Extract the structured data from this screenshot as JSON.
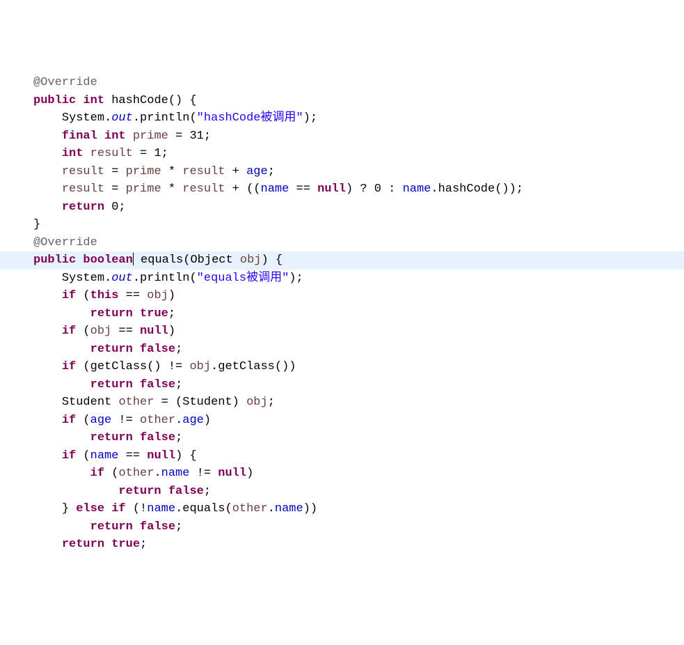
{
  "lines": [
    {
      "indent": 0,
      "tokens": [
        {
          "cls": "annotation",
          "t": "@Override"
        }
      ]
    },
    {
      "indent": 0,
      "tokens": [
        {
          "cls": "keyword",
          "t": "public"
        },
        {
          "cls": "",
          "t": " "
        },
        {
          "cls": "keyword",
          "t": "int"
        },
        {
          "cls": "",
          "t": " "
        },
        {
          "cls": "method",
          "t": "hashCode"
        },
        {
          "cls": "paren",
          "t": "() {"
        }
      ]
    },
    {
      "indent": 1,
      "tokens": [
        {
          "cls": "",
          "t": "System."
        },
        {
          "cls": "static-field",
          "t": "out"
        },
        {
          "cls": "",
          "t": ".println("
        },
        {
          "cls": "string",
          "t": "\"hashCode被调用\""
        },
        {
          "cls": "",
          "t": ");"
        }
      ]
    },
    {
      "indent": 1,
      "tokens": [
        {
          "cls": "keyword",
          "t": "final"
        },
        {
          "cls": "",
          "t": " "
        },
        {
          "cls": "keyword",
          "t": "int"
        },
        {
          "cls": "",
          "t": " "
        },
        {
          "cls": "ident",
          "t": "prime"
        },
        {
          "cls": "",
          "t": " = 31;"
        }
      ]
    },
    {
      "indent": 1,
      "tokens": [
        {
          "cls": "keyword",
          "t": "int"
        },
        {
          "cls": "",
          "t": " "
        },
        {
          "cls": "ident",
          "t": "result"
        },
        {
          "cls": "",
          "t": " = 1;"
        }
      ]
    },
    {
      "indent": 1,
      "tokens": [
        {
          "cls": "ident",
          "t": "result"
        },
        {
          "cls": "",
          "t": " = "
        },
        {
          "cls": "ident",
          "t": "prime"
        },
        {
          "cls": "",
          "t": " * "
        },
        {
          "cls": "ident",
          "t": "result"
        },
        {
          "cls": "",
          "t": " + "
        },
        {
          "cls": "field",
          "t": "age"
        },
        {
          "cls": "",
          "t": ";"
        }
      ]
    },
    {
      "indent": 1,
      "tokens": [
        {
          "cls": "ident",
          "t": "result"
        },
        {
          "cls": "",
          "t": " = "
        },
        {
          "cls": "ident",
          "t": "prime"
        },
        {
          "cls": "",
          "t": " * "
        },
        {
          "cls": "ident",
          "t": "result"
        },
        {
          "cls": "",
          "t": " + (("
        },
        {
          "cls": "field",
          "t": "name"
        },
        {
          "cls": "",
          "t": " == "
        },
        {
          "cls": "keyword",
          "t": "null"
        },
        {
          "cls": "",
          "t": ") ? 0 : "
        },
        {
          "cls": "field",
          "t": "name"
        },
        {
          "cls": "",
          "t": ".hashCode());"
        }
      ]
    },
    {
      "indent": 1,
      "tokens": [
        {
          "cls": "keyword",
          "t": "return"
        },
        {
          "cls": "",
          "t": " 0;"
        }
      ]
    },
    {
      "indent": 0,
      "tokens": [
        {
          "cls": "",
          "t": "}"
        }
      ]
    },
    {
      "indent": 0,
      "tokens": [
        {
          "cls": "annotation",
          "t": "@Override"
        }
      ]
    },
    {
      "indent": 0,
      "highlight": true,
      "tokens": [
        {
          "cls": "keyword",
          "t": "public"
        },
        {
          "cls": "",
          "t": " "
        },
        {
          "cls": "keyword",
          "t": "boolean"
        },
        {
          "cls": "",
          "t": "",
          "cursor": true
        },
        {
          "cls": "",
          "t": " "
        },
        {
          "cls": "method",
          "t": "equals"
        },
        {
          "cls": "",
          "t": "(Object "
        },
        {
          "cls": "ident",
          "t": "obj"
        },
        {
          "cls": "",
          "t": ") {"
        }
      ]
    },
    {
      "indent": 1,
      "tokens": [
        {
          "cls": "",
          "t": "System."
        },
        {
          "cls": "static-field",
          "t": "out"
        },
        {
          "cls": "",
          "t": ".println("
        },
        {
          "cls": "string",
          "t": "\"equals被调用\""
        },
        {
          "cls": "",
          "t": ");"
        }
      ]
    },
    {
      "indent": 1,
      "tokens": [
        {
          "cls": "keyword",
          "t": "if"
        },
        {
          "cls": "",
          "t": " ("
        },
        {
          "cls": "keyword",
          "t": "this"
        },
        {
          "cls": "",
          "t": " == "
        },
        {
          "cls": "ident",
          "t": "obj"
        },
        {
          "cls": "",
          "t": ")"
        }
      ]
    },
    {
      "indent": 2,
      "tokens": [
        {
          "cls": "keyword",
          "t": "return"
        },
        {
          "cls": "",
          "t": " "
        },
        {
          "cls": "keyword",
          "t": "true"
        },
        {
          "cls": "",
          "t": ";"
        }
      ]
    },
    {
      "indent": 1,
      "tokens": [
        {
          "cls": "keyword",
          "t": "if"
        },
        {
          "cls": "",
          "t": " ("
        },
        {
          "cls": "ident",
          "t": "obj"
        },
        {
          "cls": "",
          "t": " == "
        },
        {
          "cls": "keyword",
          "t": "null"
        },
        {
          "cls": "",
          "t": ")"
        }
      ]
    },
    {
      "indent": 2,
      "tokens": [
        {
          "cls": "keyword",
          "t": "return"
        },
        {
          "cls": "",
          "t": " "
        },
        {
          "cls": "keyword",
          "t": "false"
        },
        {
          "cls": "",
          "t": ";"
        }
      ]
    },
    {
      "indent": 1,
      "tokens": [
        {
          "cls": "keyword",
          "t": "if"
        },
        {
          "cls": "",
          "t": " (getClass() != "
        },
        {
          "cls": "ident",
          "t": "obj"
        },
        {
          "cls": "",
          "t": ".getClass())"
        }
      ]
    },
    {
      "indent": 2,
      "tokens": [
        {
          "cls": "keyword",
          "t": "return"
        },
        {
          "cls": "",
          "t": " "
        },
        {
          "cls": "keyword",
          "t": "false"
        },
        {
          "cls": "",
          "t": ";"
        }
      ]
    },
    {
      "indent": 1,
      "tokens": [
        {
          "cls": "",
          "t": "Student "
        },
        {
          "cls": "ident",
          "t": "other"
        },
        {
          "cls": "",
          "t": " = (Student) "
        },
        {
          "cls": "ident",
          "t": "obj"
        },
        {
          "cls": "",
          "t": ";"
        }
      ]
    },
    {
      "indent": 1,
      "tokens": [
        {
          "cls": "keyword",
          "t": "if"
        },
        {
          "cls": "",
          "t": " ("
        },
        {
          "cls": "field",
          "t": "age"
        },
        {
          "cls": "",
          "t": " != "
        },
        {
          "cls": "ident",
          "t": "other"
        },
        {
          "cls": "",
          "t": "."
        },
        {
          "cls": "field",
          "t": "age"
        },
        {
          "cls": "",
          "t": ")"
        }
      ]
    },
    {
      "indent": 2,
      "tokens": [
        {
          "cls": "keyword",
          "t": "return"
        },
        {
          "cls": "",
          "t": " "
        },
        {
          "cls": "keyword",
          "t": "false"
        },
        {
          "cls": "",
          "t": ";"
        }
      ]
    },
    {
      "indent": 1,
      "tokens": [
        {
          "cls": "keyword",
          "t": "if"
        },
        {
          "cls": "",
          "t": " ("
        },
        {
          "cls": "field",
          "t": "name"
        },
        {
          "cls": "",
          "t": " == "
        },
        {
          "cls": "keyword",
          "t": "null"
        },
        {
          "cls": "",
          "t": ") {"
        }
      ]
    },
    {
      "indent": 2,
      "tokens": [
        {
          "cls": "keyword",
          "t": "if"
        },
        {
          "cls": "",
          "t": " ("
        },
        {
          "cls": "ident",
          "t": "other"
        },
        {
          "cls": "",
          "t": "."
        },
        {
          "cls": "field",
          "t": "name"
        },
        {
          "cls": "",
          "t": " != "
        },
        {
          "cls": "keyword",
          "t": "null"
        },
        {
          "cls": "",
          "t": ")"
        }
      ]
    },
    {
      "indent": 3,
      "tokens": [
        {
          "cls": "keyword",
          "t": "return"
        },
        {
          "cls": "",
          "t": " "
        },
        {
          "cls": "keyword",
          "t": "false"
        },
        {
          "cls": "",
          "t": ";"
        }
      ]
    },
    {
      "indent": 1,
      "tokens": [
        {
          "cls": "",
          "t": "} "
        },
        {
          "cls": "keyword",
          "t": "else"
        },
        {
          "cls": "",
          "t": " "
        },
        {
          "cls": "keyword",
          "t": "if"
        },
        {
          "cls": "",
          "t": " (!"
        },
        {
          "cls": "field",
          "t": "name"
        },
        {
          "cls": "",
          "t": ".equals("
        },
        {
          "cls": "ident",
          "t": "other"
        },
        {
          "cls": "",
          "t": "."
        },
        {
          "cls": "field",
          "t": "name"
        },
        {
          "cls": "",
          "t": "))"
        }
      ]
    },
    {
      "indent": 2,
      "tokens": [
        {
          "cls": "keyword",
          "t": "return"
        },
        {
          "cls": "",
          "t": " "
        },
        {
          "cls": "keyword",
          "t": "false"
        },
        {
          "cls": "",
          "t": ";"
        }
      ]
    },
    {
      "indent": 1,
      "tokens": [
        {
          "cls": "keyword",
          "t": "return"
        },
        {
          "cls": "",
          "t": " "
        },
        {
          "cls": "keyword",
          "t": "true"
        },
        {
          "cls": "",
          "t": ";"
        }
      ]
    }
  ],
  "indent_unit": "    "
}
